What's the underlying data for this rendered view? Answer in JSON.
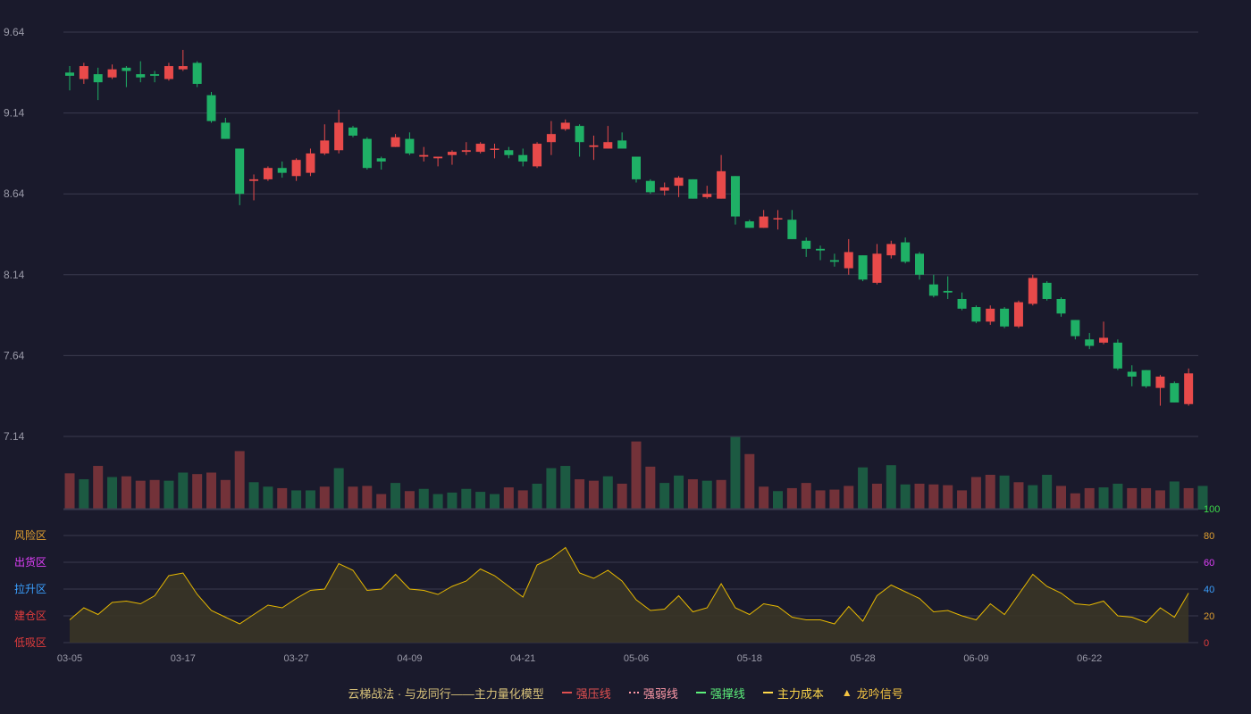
{
  "colors": {
    "background": "#1a1a2c",
    "up": "#e84a4a",
    "down": "#1fb066",
    "up_volume": "#733239",
    "down_volume": "#1c5a42",
    "grid": "#3a3a4e",
    "axis_text": "#9a9aa8",
    "oscillator_line": "#e6b800",
    "oscillator_fill": "#3a3526"
  },
  "legend": [
    {
      "label": "云梯战法 · 与龙同行——主力量化模型",
      "symbol": "none",
      "color": "#d8c27a"
    },
    {
      "label": "强压线",
      "symbol": "solid-line",
      "color": "#e05050"
    },
    {
      "label": "强弱线",
      "symbol": "dotted-line",
      "color": "#ff9aa8"
    },
    {
      "label": "强撑线",
      "symbol": "solid-line",
      "color": "#5cf07a"
    },
    {
      "label": "主力成本",
      "symbol": "dashed-line",
      "color": "#ffd84a"
    },
    {
      "label": "龙吟信号",
      "symbol": "triangle",
      "color": "#f5c542"
    }
  ],
  "chart_data": [
    {
      "type": "candlestick",
      "y_ticks": [
        "7.14",
        "7.64",
        "8.14",
        "8.64",
        "9.14",
        "9.64"
      ],
      "ylim": [
        7.14,
        9.64
      ],
      "grid": true,
      "x_tick_labels": [
        "03-05",
        "03-17",
        "03-27",
        "04-09",
        "04-21",
        "05-06",
        "05-18",
        "05-28",
        "06-09",
        "06-22"
      ],
      "x_tick_index": [
        0,
        8,
        16,
        24,
        32,
        40,
        48,
        56,
        64,
        72
      ],
      "candles": [
        [
          9.39,
          9.37,
          9.43,
          9.28
        ],
        [
          9.35,
          9.43,
          9.45,
          9.32
        ],
        [
          9.38,
          9.33,
          9.42,
          9.22
        ],
        [
          9.36,
          9.41,
          9.44,
          9.35
        ],
        [
          9.42,
          9.4,
          9.43,
          9.3
        ],
        [
          9.38,
          9.36,
          9.46,
          9.33
        ],
        [
          9.38,
          9.37,
          9.4,
          9.33
        ],
        [
          9.35,
          9.43,
          9.45,
          9.34
        ],
        [
          9.41,
          9.43,
          9.53,
          9.4
        ],
        [
          9.45,
          9.32,
          9.46,
          9.3
        ],
        [
          9.25,
          9.09,
          9.27,
          9.08
        ],
        [
          9.08,
          8.98,
          9.11,
          8.98
        ],
        [
          8.92,
          8.64,
          8.92,
          8.57
        ],
        [
          8.72,
          8.73,
          8.76,
          8.6
        ],
        [
          8.73,
          8.8,
          8.81,
          8.72
        ],
        [
          8.8,
          8.77,
          8.84,
          8.74
        ],
        [
          8.75,
          8.85,
          8.86,
          8.72
        ],
        [
          8.77,
          8.89,
          8.92,
          8.75
        ],
        [
          8.89,
          8.97,
          9.07,
          8.88
        ],
        [
          8.91,
          9.08,
          9.16,
          8.89
        ],
        [
          9.05,
          9.0,
          9.06,
          8.99
        ],
        [
          8.98,
          8.8,
          8.99,
          8.79
        ],
        [
          8.86,
          8.84,
          8.87,
          8.79
        ],
        [
          8.93,
          8.99,
          9.01,
          8.93
        ],
        [
          8.98,
          8.89,
          9.02,
          8.88
        ],
        [
          8.87,
          8.88,
          8.93,
          8.84
        ],
        [
          8.86,
          8.87,
          8.87,
          8.81
        ],
        [
          8.88,
          8.9,
          8.91,
          8.82
        ],
        [
          8.9,
          8.91,
          8.96,
          8.88
        ],
        [
          8.9,
          8.95,
          8.96,
          8.89
        ],
        [
          8.92,
          8.92,
          8.95,
          8.86
        ],
        [
          8.91,
          8.88,
          8.93,
          8.86
        ],
        [
          8.88,
          8.84,
          8.92,
          8.81
        ],
        [
          8.81,
          8.95,
          8.96,
          8.8
        ],
        [
          8.96,
          9.01,
          9.09,
          8.88
        ],
        [
          9.04,
          9.08,
          9.1,
          9.03
        ],
        [
          9.06,
          8.96,
          9.07,
          8.87
        ],
        [
          8.93,
          8.94,
          9.0,
          8.85
        ],
        [
          8.92,
          8.96,
          9.06,
          8.92
        ],
        [
          8.97,
          8.92,
          9.02,
          8.92
        ],
        [
          8.87,
          8.73,
          8.87,
          8.71
        ],
        [
          8.72,
          8.65,
          8.73,
          8.64
        ],
        [
          8.66,
          8.68,
          8.71,
          8.63
        ],
        [
          8.69,
          8.74,
          8.75,
          8.62
        ],
        [
          8.73,
          8.61,
          8.73,
          8.61
        ],
        [
          8.62,
          8.64,
          8.69,
          8.61
        ],
        [
          8.61,
          8.78,
          8.88,
          8.61
        ],
        [
          8.75,
          8.5,
          8.75,
          8.45
        ],
        [
          8.47,
          8.43,
          8.48,
          8.43
        ],
        [
          8.43,
          8.5,
          8.54,
          8.43
        ],
        [
          8.49,
          8.49,
          8.54,
          8.42
        ],
        [
          8.48,
          8.36,
          8.54,
          8.36
        ],
        [
          8.35,
          8.3,
          8.37,
          8.25
        ],
        [
          8.3,
          8.29,
          8.32,
          8.23
        ],
        [
          8.23,
          8.22,
          8.27,
          8.19
        ],
        [
          8.18,
          8.28,
          8.36,
          8.14
        ],
        [
          8.26,
          8.11,
          8.26,
          8.1
        ],
        [
          8.09,
          8.27,
          8.33,
          8.08
        ],
        [
          8.26,
          8.33,
          8.35,
          8.24
        ],
        [
          8.34,
          8.22,
          8.37,
          8.21
        ],
        [
          8.27,
          8.14,
          8.28,
          8.11
        ],
        [
          8.08,
          8.01,
          8.14,
          8.0
        ],
        [
          8.04,
          8.03,
          8.13,
          7.99
        ],
        [
          7.99,
          7.93,
          8.03,
          7.92
        ],
        [
          7.94,
          7.85,
          7.95,
          7.84
        ],
        [
          7.85,
          7.93,
          7.95,
          7.83
        ],
        [
          7.93,
          7.82,
          7.94,
          7.81
        ],
        [
          7.82,
          7.97,
          7.98,
          7.81
        ],
        [
          7.96,
          8.12,
          8.14,
          7.95
        ],
        [
          8.09,
          7.99,
          8.1,
          7.98
        ],
        [
          7.99,
          7.9,
          8.0,
          7.88
        ],
        [
          7.86,
          7.76,
          7.86,
          7.74
        ],
        [
          7.74,
          7.7,
          7.78,
          7.68
        ],
        [
          7.72,
          7.75,
          7.85,
          7.71
        ],
        [
          7.72,
          7.56,
          7.74,
          7.55
        ],
        [
          7.54,
          7.51,
          7.58,
          7.45
        ],
        [
          7.55,
          7.45,
          7.55,
          7.44
        ],
        [
          7.44,
          7.51,
          7.52,
          7.33
        ],
        [
          7.47,
          7.35,
          7.48,
          7.35
        ],
        [
          7.34,
          7.53,
          7.56,
          7.33
        ]
      ],
      "volume": [
        [
          0.49,
          1
        ],
        [
          0.41,
          0
        ],
        [
          0.59,
          1
        ],
        [
          0.44,
          0
        ],
        [
          0.45,
          1
        ],
        [
          0.39,
          1
        ],
        [
          0.4,
          1
        ],
        [
          0.39,
          0
        ],
        [
          0.5,
          0
        ],
        [
          0.48,
          1
        ],
        [
          0.5,
          1
        ],
        [
          0.4,
          1
        ],
        [
          0.79,
          1
        ],
        [
          0.37,
          0
        ],
        [
          0.31,
          0
        ],
        [
          0.29,
          1
        ],
        [
          0.26,
          0
        ],
        [
          0.26,
          0
        ],
        [
          0.31,
          1
        ],
        [
          0.56,
          0
        ],
        [
          0.31,
          1
        ],
        [
          0.32,
          1
        ],
        [
          0.21,
          1
        ],
        [
          0.36,
          0
        ],
        [
          0.25,
          1
        ],
        [
          0.28,
          0
        ],
        [
          0.21,
          0
        ],
        [
          0.23,
          0
        ],
        [
          0.28,
          0
        ],
        [
          0.24,
          0
        ],
        [
          0.21,
          0
        ],
        [
          0.3,
          1
        ],
        [
          0.26,
          1
        ],
        [
          0.35,
          0
        ],
        [
          0.56,
          0
        ],
        [
          0.59,
          0
        ],
        [
          0.41,
          1
        ],
        [
          0.39,
          1
        ],
        [
          0.45,
          0
        ],
        [
          0.35,
          1
        ],
        [
          0.92,
          1
        ],
        [
          0.58,
          1
        ],
        [
          0.36,
          0
        ],
        [
          0.46,
          0
        ],
        [
          0.41,
          1
        ],
        [
          0.39,
          0
        ],
        [
          0.4,
          1
        ],
        [
          0.98,
          0
        ],
        [
          0.75,
          1
        ],
        [
          0.31,
          1
        ],
        [
          0.25,
          0
        ],
        [
          0.29,
          1
        ],
        [
          0.36,
          1
        ],
        [
          0.26,
          1
        ],
        [
          0.27,
          1
        ],
        [
          0.32,
          1
        ],
        [
          0.57,
          0
        ],
        [
          0.35,
          1
        ],
        [
          0.6,
          0
        ],
        [
          0.34,
          0
        ],
        [
          0.35,
          1
        ],
        [
          0.34,
          1
        ],
        [
          0.33,
          1
        ],
        [
          0.26,
          1
        ],
        [
          0.44,
          1
        ],
        [
          0.47,
          1
        ],
        [
          0.46,
          0
        ],
        [
          0.37,
          1
        ],
        [
          0.33,
          0
        ],
        [
          0.47,
          0
        ],
        [
          0.32,
          1
        ],
        [
          0.22,
          1
        ],
        [
          0.29,
          1
        ],
        [
          0.3,
          0
        ],
        [
          0.35,
          0
        ],
        [
          0.29,
          1
        ],
        [
          0.29,
          1
        ],
        [
          0.26,
          1
        ],
        [
          0.38,
          0
        ],
        [
          0.29,
          1
        ],
        [
          0.32,
          0
        ]
      ]
    },
    {
      "type": "area",
      "y_ticks": [
        "0",
        "20",
        "40",
        "60",
        "80",
        "100"
      ],
      "y_tick_colors": [
        "#e03c3c",
        "#e0a030",
        "#3aa0ff",
        "#e040fb",
        "#e0a030",
        "#3cdc4a"
      ],
      "ylim": [
        0,
        100
      ],
      "zone_labels": [
        {
          "label": "低吸区",
          "value": 0,
          "color": "#e03c3c"
        },
        {
          "label": "建仓区",
          "value": 20,
          "color": "#e03c3c"
        },
        {
          "label": "拉升区",
          "value": 40,
          "color": "#3aa0ff"
        },
        {
          "label": "出货区",
          "value": 60,
          "color": "#e040fb"
        },
        {
          "label": "风险区",
          "value": 80,
          "color": "#e0a030"
        }
      ],
      "values": [
        17,
        26,
        21,
        30,
        31,
        29,
        35,
        50,
        52,
        36,
        24,
        19,
        14,
        21,
        28,
        26,
        33,
        39,
        40,
        59,
        54,
        39,
        40,
        51,
        40,
        39,
        36,
        42,
        46,
        55,
        50,
        42,
        34,
        58,
        63,
        71,
        52,
        48,
        54,
        46,
        32,
        24,
        25,
        35,
        23,
        26,
        44,
        26,
        21,
        29,
        27,
        19,
        17,
        17,
        14,
        27,
        16,
        35,
        43,
        38,
        33,
        23,
        24,
        20,
        17,
        29,
        21,
        36,
        51,
        42,
        37,
        29,
        28,
        31,
        20,
        19,
        15,
        26,
        19,
        37
      ]
    }
  ]
}
